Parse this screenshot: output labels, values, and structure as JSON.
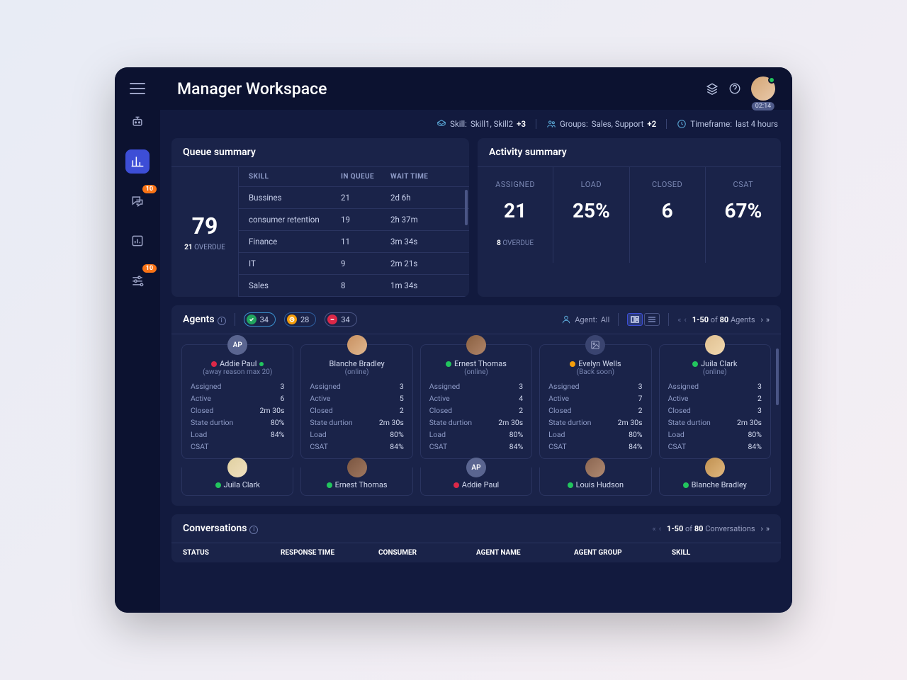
{
  "header": {
    "title": "Manager Workspace",
    "timer": "02:14"
  },
  "sidebar": {
    "badges": {
      "chat": "10",
      "sliders": "10"
    }
  },
  "filters": {
    "skill_label": "Skill:",
    "skill_value": "Skill1, Skill2",
    "skill_extra": "+3",
    "groups_label": "Groups:",
    "groups_value": "Sales, Support",
    "groups_extra": "+2",
    "timeframe_label": "Timeframe:",
    "timeframe_value": "last 4 hours"
  },
  "queue": {
    "title": "Queue summary",
    "total": "79",
    "overdue_count": "21",
    "overdue_label": "OVERDUE",
    "columns": {
      "c1": "SKILL",
      "c2": "IN QUEUE",
      "c3": "WAIT TIME"
    },
    "rows": [
      {
        "skill": "Bussines",
        "inqueue": "21",
        "wait": "2d 6h"
      },
      {
        "skill": "consumer retention",
        "inqueue": "19",
        "wait": "2h 37m"
      },
      {
        "skill": "Finance",
        "inqueue": "11",
        "wait": "3m 34s"
      },
      {
        "skill": "IT",
        "inqueue": "9",
        "wait": "2m 21s"
      },
      {
        "skill": "Sales",
        "inqueue": "8",
        "wait": "1m 34s"
      }
    ]
  },
  "activity": {
    "title": "Activity summary",
    "cols": [
      {
        "label": "ASSIGNED",
        "value": "21",
        "overdue_count": "8",
        "overdue_label": "OVERDUE"
      },
      {
        "label": "LOAD",
        "value": "25%"
      },
      {
        "label": "CLOSED",
        "value": "6"
      },
      {
        "label": "CSAT",
        "value": "67%"
      }
    ]
  },
  "agents": {
    "title": "Agents",
    "pills": {
      "green": "34",
      "yellow": "28",
      "red": "34"
    },
    "filter_label": "Agent:",
    "filter_value": "All",
    "pager_range": "1-50",
    "pager_of": "of",
    "pager_total": "80",
    "pager_unit": "Agents",
    "stat_labels": {
      "assigned": "Assigned",
      "active": "Active",
      "closed": "Closed",
      "state": "State durtion",
      "load": "Load",
      "csat": "CSAT"
    },
    "cards": [
      {
        "initials": "AP",
        "name": "Addie Paul",
        "status": "(away reason max 20)",
        "dot": "busy",
        "trailing": true,
        "assigned": "3",
        "active": "6",
        "closed": "2m 30s",
        "state": "80%",
        "load": "84%",
        "csat": ""
      },
      {
        "name": "Blanche Bradley",
        "status": "(online)",
        "dot": "",
        "assigned": "3",
        "active": "5",
        "closed": "2",
        "state": "2m 30s",
        "load": "80%",
        "csat": "84%"
      },
      {
        "name": "Ernest Thomas",
        "status": "(online)",
        "dot": "online",
        "assigned": "3",
        "active": "4",
        "closed": "2",
        "state": "2m 30s",
        "load": "80%",
        "csat": "84%"
      },
      {
        "placeholder": true,
        "name": "Evelyn Wells",
        "status": "(Back soon)",
        "dot": "away",
        "assigned": "3",
        "active": "7",
        "closed": "2",
        "state": "2m 30s",
        "load": "80%",
        "csat": "84%"
      },
      {
        "name": "Juila Clark",
        "status": "(online)",
        "dot": "online",
        "assigned": "3",
        "active": "2",
        "closed": "3",
        "state": "2m 30s",
        "load": "80%",
        "csat": "84%"
      }
    ],
    "row2": [
      {
        "name": "Juila Clark",
        "dot": "online"
      },
      {
        "name": "Ernest Thomas",
        "dot": "online"
      },
      {
        "initials": "AP",
        "name": "Addie Paul",
        "dot": "busy"
      },
      {
        "name": "Louis Hudson",
        "dot": "online"
      },
      {
        "name": "Blanche Bradley",
        "dot": "online"
      }
    ]
  },
  "conversations": {
    "title": "Conversations",
    "pager_range": "1-50",
    "pager_of": "of",
    "pager_total": "80",
    "pager_unit": "Conversations",
    "columns": {
      "c1": "STATUS",
      "c2": "RESPONSE TIME",
      "c3": "CONSUMER",
      "c4": "AGENT NAME",
      "c5": "AGENT GROUP",
      "c6": "SKILL"
    }
  }
}
